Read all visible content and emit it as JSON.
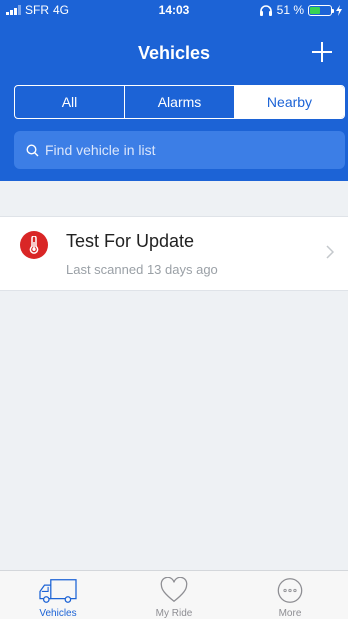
{
  "status_bar": {
    "carrier": "SFR",
    "network": "4G",
    "time": "14:03",
    "battery": "51 %",
    "battery_level": 0.51
  },
  "nav": {
    "title": "Vehicles"
  },
  "segments": [
    {
      "label": "All",
      "active": false
    },
    {
      "label": "Alarms",
      "active": false
    },
    {
      "label": "Nearby",
      "active": true
    }
  ],
  "search": {
    "placeholder": "Find vehicle in list"
  },
  "vehicles": [
    {
      "name": "Test For Update",
      "subtitle": "Last scanned 13 days ago",
      "icon": "thermometer-icon",
      "icon_color": "#d92626"
    }
  ],
  "tabs": [
    {
      "label": "Vehicles",
      "icon": "truck-icon",
      "active": true
    },
    {
      "label": "My Ride",
      "icon": "heart-icon",
      "active": false
    },
    {
      "label": "More",
      "icon": "more-icon",
      "active": false
    }
  ],
  "colors": {
    "primary": "#1c63d6",
    "alert": "#d92626",
    "battery": "#39d353"
  }
}
